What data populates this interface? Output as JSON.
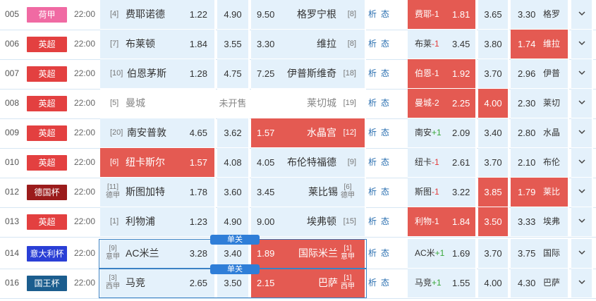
{
  "colors": {
    "hl": "#e45a52",
    "cell": "#e4f1fb",
    "link": "#2a6fb0",
    "danguan": "#2f7ed8"
  },
  "link_labels": {
    "analysis": "析",
    "state": "态"
  },
  "arrow_icon": "chevron-down-icon",
  "rows": [
    {
      "num": "005",
      "league": "荷甲",
      "league_color": "#f06aa3",
      "time": "22:00",
      "home_rank": "[4]",
      "home": "费耶诺德",
      "odd_home": "1.22",
      "odd_draw": "4.90",
      "odd_away": "9.50",
      "away": "格罗宁根",
      "away_rank": "[8]",
      "r_label": "费耶",
      "r_sign": "-1",
      "r_color": "red",
      "r1": "1.81",
      "r2": "3.65",
      "r3": "3.30",
      "r_away": "格罗"
    },
    {
      "num": "006",
      "league": "英超",
      "league_color": "#e34040",
      "time": "22:00",
      "home_rank": "[7]",
      "home": "布莱顿",
      "odd_home": "1.84",
      "odd_draw": "3.55",
      "odd_away": "3.30",
      "away": "维拉",
      "away_rank": "[8]",
      "r_label": "布莱",
      "r_sign": "-1",
      "r_color": "red",
      "r1": "3.45",
      "r2": "3.80",
      "r3": "1.74",
      "r_away": "维拉"
    },
    {
      "num": "007",
      "league": "英超",
      "league_color": "#e34040",
      "time": "22:00",
      "home_rank": "[10]",
      "home": "伯恩茅斯",
      "odd_home": "1.28",
      "odd_draw": "4.75",
      "odd_away": "7.25",
      "away": "伊普斯维奇",
      "away_rank": "[18]",
      "r_label": "伯恩",
      "r_sign": "-1",
      "r_color": "red",
      "r1": "1.92",
      "r2": "3.70",
      "r3": "2.96",
      "r_away": "伊普"
    },
    {
      "num": "008",
      "league": "英超",
      "league_color": "#e34040",
      "time": "22:00",
      "home_rank": "[5]",
      "home": "曼城",
      "odd_home": "",
      "odd_draw": "未开售",
      "odd_away": "",
      "away": "莱切城",
      "away_rank": "[19]",
      "r_label": "曼城",
      "r_sign": "-2",
      "r_color": "red",
      "r1": "2.25",
      "r2": "4.00",
      "r3": "2.30",
      "r_away": "莱切"
    },
    {
      "num": "009",
      "league": "英超",
      "league_color": "#e34040",
      "time": "22:00",
      "home_rank": "[20]",
      "home": "南安普敦",
      "odd_home": "4.65",
      "odd_draw": "3.62",
      "odd_away": "1.57",
      "away": "水晶宫",
      "away_rank": "[12]",
      "r_label": "南安",
      "r_sign": "+1",
      "r_color": "green",
      "r1": "2.09",
      "r2": "3.40",
      "r3": "2.80",
      "r_away": "水晶"
    },
    {
      "num": "010",
      "league": "英超",
      "league_color": "#e34040",
      "time": "22:00",
      "home_rank": "[6]",
      "home": "纽卡斯尔",
      "odd_home": "1.57",
      "odd_draw": "4.08",
      "odd_away": "4.05",
      "away": "布伦特福德",
      "away_rank": "[9]",
      "r_label": "纽卡",
      "r_sign": "-1",
      "r_color": "red",
      "r1": "2.61",
      "r2": "3.70",
      "r3": "2.10",
      "r_away": "布伦"
    },
    {
      "num": "012",
      "league": "德国杯",
      "league_color": "#9b1b1b",
      "time": "22:00",
      "home_rank": "[11]",
      "home_rank_sub": "德甲",
      "home": "斯图加特",
      "odd_home": "1.78",
      "odd_draw": "3.60",
      "odd_away": "3.45",
      "away": "莱比锡",
      "away_rank": "[6]",
      "away_rank_sub": "德甲",
      "r_label": "斯图",
      "r_sign": "-1",
      "r_color": "red",
      "r1": "3.22",
      "r2": "3.85",
      "r3": "1.79",
      "r_away": "莱比"
    },
    {
      "num": "013",
      "league": "英超",
      "league_color": "#e34040",
      "time": "22:00",
      "home_rank": "[1]",
      "home": "利物浦",
      "odd_home": "1.23",
      "odd_draw": "4.90",
      "odd_away": "9.00",
      "away": "埃弗顿",
      "away_rank": "[15]",
      "r_label": "利物",
      "r_sign": "-1",
      "r_color": "red",
      "r1": "1.84",
      "r2": "3.50",
      "r3": "3.33",
      "r_away": "埃弗"
    },
    {
      "num": "014",
      "league": "意大利杯",
      "league_color": "#2a3fd6",
      "time": "22:00",
      "home_rank": "[9]",
      "home_rank_sub": "意甲",
      "home": "AC米兰",
      "odd_home": "3.28",
      "odd_draw": "3.40",
      "odd_away": "1.89",
      "away": "国际米兰",
      "away_rank": "[1]",
      "away_rank_sub": "意甲",
      "r_label": "AC米",
      "r_sign": "+1",
      "r_color": "green",
      "r1": "1.69",
      "r2": "3.70",
      "r3": "3.75",
      "r_away": "国际",
      "danguan": "单关"
    },
    {
      "num": "016",
      "league": "国王杯",
      "league_color": "#1b5d8e",
      "time": "22:00",
      "home_rank": "[3]",
      "home_rank_sub": "西甲",
      "home": "马竞",
      "odd_home": "2.65",
      "odd_draw": "3.50",
      "odd_away": "2.15",
      "away": "巴萨",
      "away_rank": "[1]",
      "away_rank_sub": "西甲",
      "r_label": "马竞",
      "r_sign": "+1",
      "r_color": "green",
      "r1": "1.55",
      "r2": "4.00",
      "r3": "4.30",
      "r_away": "巴萨",
      "danguan": "单关"
    }
  ]
}
